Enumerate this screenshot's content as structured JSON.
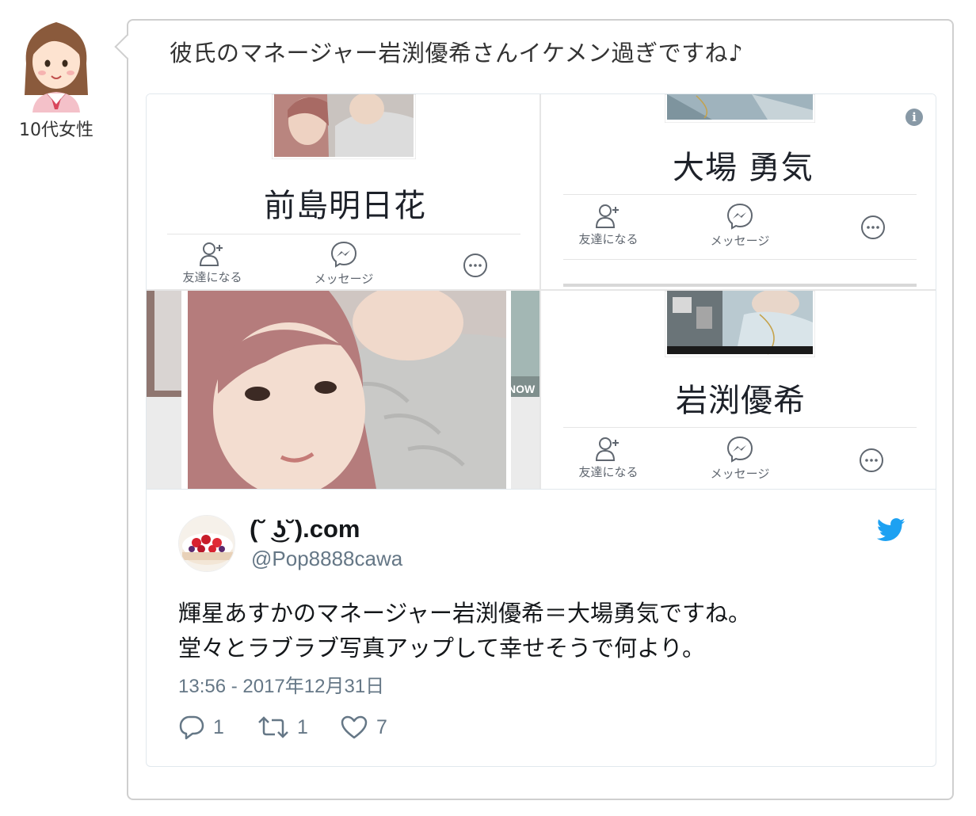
{
  "commenter": {
    "label": "10代女性"
  },
  "comment": {
    "text": "彼氏のマネージャー岩渕優希さんイケメン過ぎですね♪"
  },
  "media": {
    "tiles": {
      "top_left": {
        "name": "前島明日花",
        "actions": {
          "add_friend": "友達になる",
          "message": "メッセージ"
        }
      },
      "top_right": {
        "name": "大場 勇気",
        "actions": {
          "add_friend": "友達になる",
          "message": "メッセージ"
        }
      },
      "bottom_left": {
        "badge": "NOW"
      },
      "bottom_right": {
        "name": "岩渕優希",
        "actions": {
          "add_friend": "友達になる",
          "message": "メッセージ"
        }
      }
    }
  },
  "tweet": {
    "display_name": "(˘ ͜ʖ˘).com",
    "screen_name": "@Pop8888cawa",
    "text_line1": "輝星あすかのマネージャー岩渕優希＝大場勇気ですね。",
    "text_line2": "堂々とラブラブ写真アップして幸せそうで何より。",
    "timestamp": "13:56 - 2017年12月31日",
    "replies": "1",
    "retweets": "1",
    "likes": "7"
  },
  "colors": {
    "twitter_blue": "#1da1f2",
    "muted_gray": "#657786",
    "border": "#e1e8ed"
  }
}
